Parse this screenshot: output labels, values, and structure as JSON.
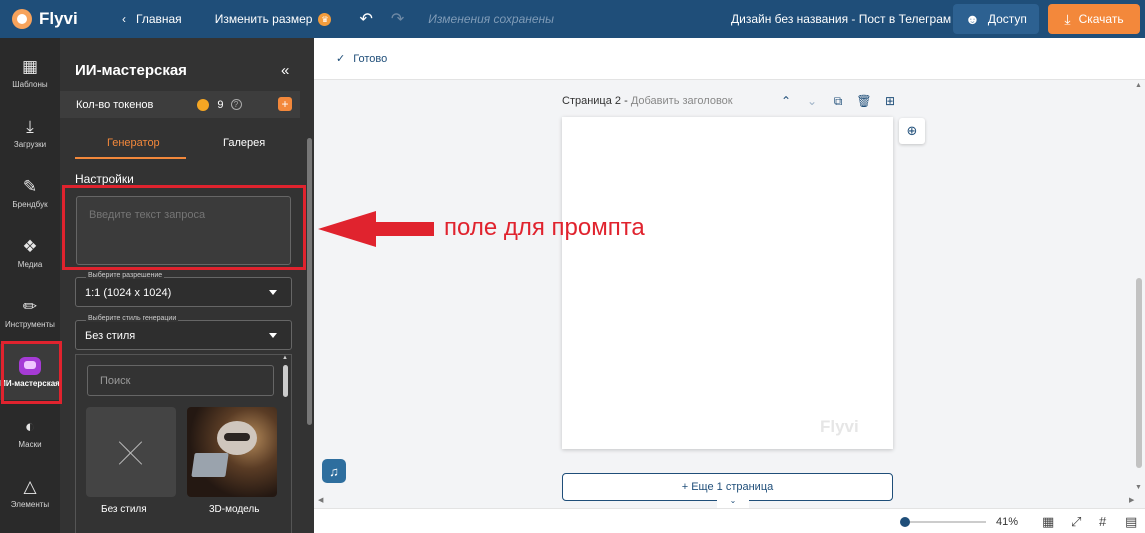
{
  "topbar": {
    "logo": "Flyvi",
    "back_label": "Главная",
    "resize_label": "Изменить размер",
    "status": "Изменения сохранены",
    "doc_title": "Дизайн без названия - Пост в Телеграм ...",
    "access_label": "Доступ",
    "download_label": "Скачать"
  },
  "rail": {
    "items": [
      {
        "label": "Шаблоны",
        "icon": "templates-icon"
      },
      {
        "label": "Загрузки",
        "icon": "upload-icon"
      },
      {
        "label": "Брендбук",
        "icon": "brandbook-icon"
      },
      {
        "label": "Медиа",
        "icon": "media-icon"
      },
      {
        "label": "Инструменты",
        "icon": "pencil-icon"
      },
      {
        "label": "ИИ-мастерская",
        "icon": "ai-icon"
      },
      {
        "label": "Маски",
        "icon": "mask-icon"
      },
      {
        "label": "Элементы",
        "icon": "elements-icon"
      }
    ]
  },
  "panel": {
    "title": "ИИ-мастерская",
    "tokens_label": "Кол-во токенов",
    "tokens_count": "9",
    "tabs": [
      "Генератор",
      "Галерея"
    ],
    "settings_label": "Настройки",
    "prompt_placeholder": "Введите текст запроса",
    "resolution": {
      "legend": "Выберите разрешение",
      "value": "1:1 (1024 x 1024)"
    },
    "style": {
      "legend": "Выберите стиль генерации",
      "value": "Без стиля"
    },
    "search_placeholder": "Поиск",
    "styles": [
      {
        "label": "Без стиля"
      },
      {
        "label": "3D-модель"
      }
    ]
  },
  "canvas": {
    "ready_label": "Готово",
    "page_label": "Страница 2 -",
    "page_title_placeholder": "Добавить заголовок",
    "watermark": "Flyvi",
    "add_page_label": "+ Еще 1 страница",
    "zoom": "41%"
  },
  "annotation": {
    "text": "поле для промпта",
    "color": "#e0232e"
  },
  "colors": {
    "topbar": "#1f4e79",
    "accent": "#f3883b",
    "panel": "#333333",
    "rail": "#2a2a2a"
  }
}
